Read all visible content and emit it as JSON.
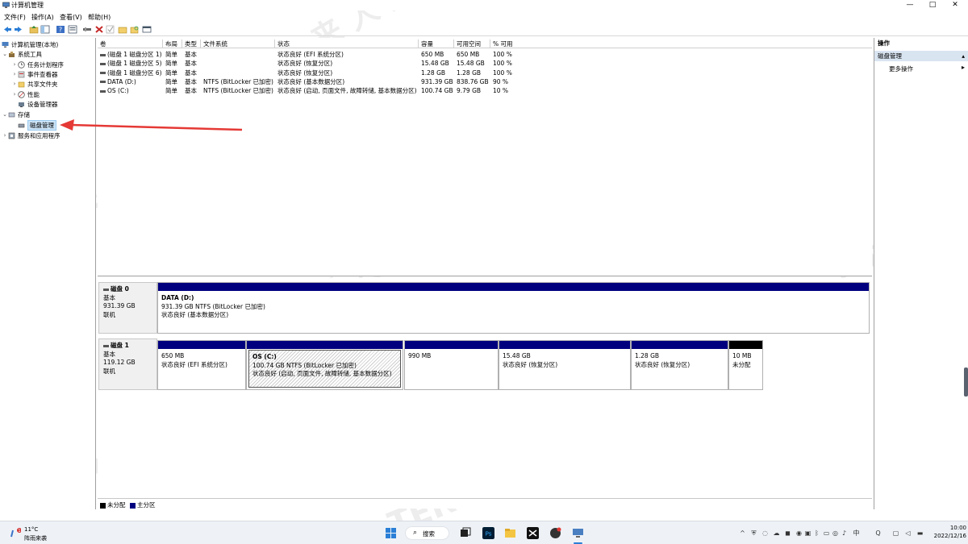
{
  "window": {
    "title": "计算机管理",
    "minimize": "—",
    "maximize": "□",
    "close": "✕"
  },
  "menu": [
    "文件(F)",
    "操作(A)",
    "查看(V)",
    "帮助(H)"
  ],
  "tree": {
    "root": "计算机管理(本地)",
    "system_tools": "系统工具",
    "task_scheduler": "任务计划程序",
    "event_viewer": "事件查看器",
    "shared_folders": "共享文件夹",
    "performance": "性能",
    "device_manager": "设备管理器",
    "storage": "存储",
    "disk_management": "磁盘管理",
    "services_apps": "服务和应用程序"
  },
  "volume_table": {
    "headers": [
      "卷",
      "布局",
      "类型",
      "文件系统",
      "状态",
      "容量",
      "可用空间",
      "% 可用"
    ],
    "rows": [
      [
        "(磁盘 1 磁盘分区 1)",
        "简单",
        "基本",
        "",
        "状态良好 (EFI 系统分区)",
        "650 MB",
        "650 MB",
        "100 %"
      ],
      [
        "(磁盘 1 磁盘分区 5)",
        "简单",
        "基本",
        "",
        "状态良好 (恢复分区)",
        "15.48 GB",
        "15.48 GB",
        "100 %"
      ],
      [
        "(磁盘 1 磁盘分区 6)",
        "简单",
        "基本",
        "",
        "状态良好 (恢复分区)",
        "1.28 GB",
        "1.28 GB",
        "100 %"
      ],
      [
        "DATA (D:)",
        "简单",
        "基本",
        "NTFS (BitLocker 已加密)",
        "状态良好 (基本数据分区)",
        "931.39 GB",
        "838.76 GB",
        "90 %"
      ],
      [
        "OS (C:)",
        "简单",
        "基本",
        "NTFS (BitLocker 已加密)",
        "状态良好 (启动, 页面文件, 故障转储, 基本数据分区)",
        "100.74 GB",
        "9.79 GB",
        "10 %"
      ]
    ]
  },
  "disks": {
    "disk0": {
      "name": "磁盘 0",
      "type": "基本",
      "size": "931.39 GB",
      "status": "联机",
      "partitions": [
        {
          "label": "DATA  (D:)",
          "line1": "931.39 GB NTFS (BitLocker 已加密)",
          "line2": "状态良好 (基本数据分区)"
        }
      ]
    },
    "disk1": {
      "name": "磁盘 1",
      "type": "基本",
      "size": "119.12 GB",
      "status": "联机",
      "partitions": [
        {
          "label": "",
          "line1": "650 MB",
          "line2": "状态良好 (EFI 系统分区)"
        },
        {
          "label": "OS  (C:)",
          "line1": "100.74 GB NTFS (BitLocker 已加密)",
          "line2": "状态良好 (启动, 页面文件, 故障转储, 基本数据分区)"
        },
        {
          "label": "",
          "line1": "990 MB",
          "line2": ""
        },
        {
          "label": "",
          "line1": "15.48 GB",
          "line2": "状态良好 (恢复分区)"
        },
        {
          "label": "",
          "line1": "1.28 GB",
          "line2": "状态良好 (恢复分区)"
        },
        {
          "label": "",
          "line1": "10 MB",
          "line2": "未分配"
        }
      ]
    }
  },
  "legend": {
    "unallocated": "未分配",
    "primary": "主分区"
  },
  "actions": {
    "header": "操作",
    "section": "磁盘管理",
    "more": "更多操作"
  },
  "colors": {
    "primary_partition": "#00007f",
    "unallocated": "#000000",
    "selection": "#cce4f7",
    "arrow": "#e53935"
  },
  "taskbar": {
    "weather_temp": "11°C",
    "weather_desc": "阵雨来袭",
    "search": "搜索",
    "time": "10:00",
    "date": "2022/12/16"
  },
  "watermark": {
    "brand": "TERRANS FORCE",
    "cn": "未 来 人 类"
  }
}
